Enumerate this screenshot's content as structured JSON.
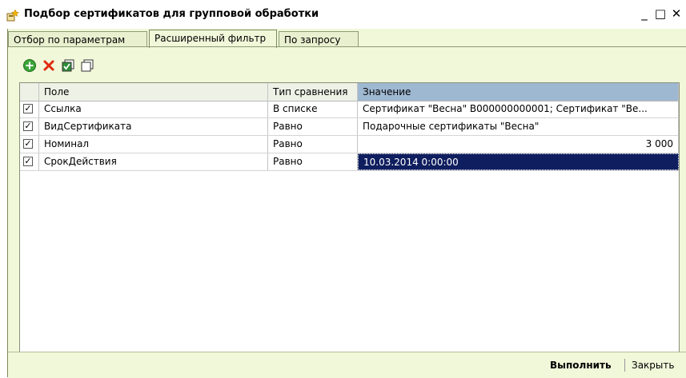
{
  "window": {
    "title": "Подбор сертификатов для групповой обработки",
    "minimize_glyph": "_",
    "maximize_glyph": "□",
    "close_glyph": "✕"
  },
  "tabs": [
    {
      "label": "Отбор по параметрам",
      "active": false
    },
    {
      "label": "Расширенный фильтр",
      "active": true
    },
    {
      "label": "По запросу",
      "active": false
    }
  ],
  "toolbar": {
    "icons": [
      "add-icon",
      "delete-icon",
      "check-all-icon",
      "uncheck-all-icon"
    ]
  },
  "grid": {
    "columns": [
      "Поле",
      "Тип сравнения",
      "Значение"
    ],
    "rows": [
      {
        "checked": true,
        "field": "Ссылка",
        "comparison": "В списке",
        "value": "Сертификат \"Весна\" В000000000001; Сертификат \"Ве..."
      },
      {
        "checked": true,
        "field": "ВидСертификата",
        "comparison": "Равно",
        "value": "Подарочные сертификаты \"Весна\""
      },
      {
        "checked": true,
        "field": "Номинал",
        "comparison": "Равно",
        "value": "3 000"
      },
      {
        "checked": true,
        "field": "СрокДействия",
        "comparison": "Равно",
        "value": "10.03.2014 0:00:00"
      }
    ]
  },
  "footer": {
    "execute_label": "Выполнить",
    "close_label": "Закрыть"
  },
  "colors": {
    "panel_bg": "#f1f7d9",
    "selected_cell_bg": "#0f1e5e",
    "selected_header_bg": "#9fb8d2"
  }
}
